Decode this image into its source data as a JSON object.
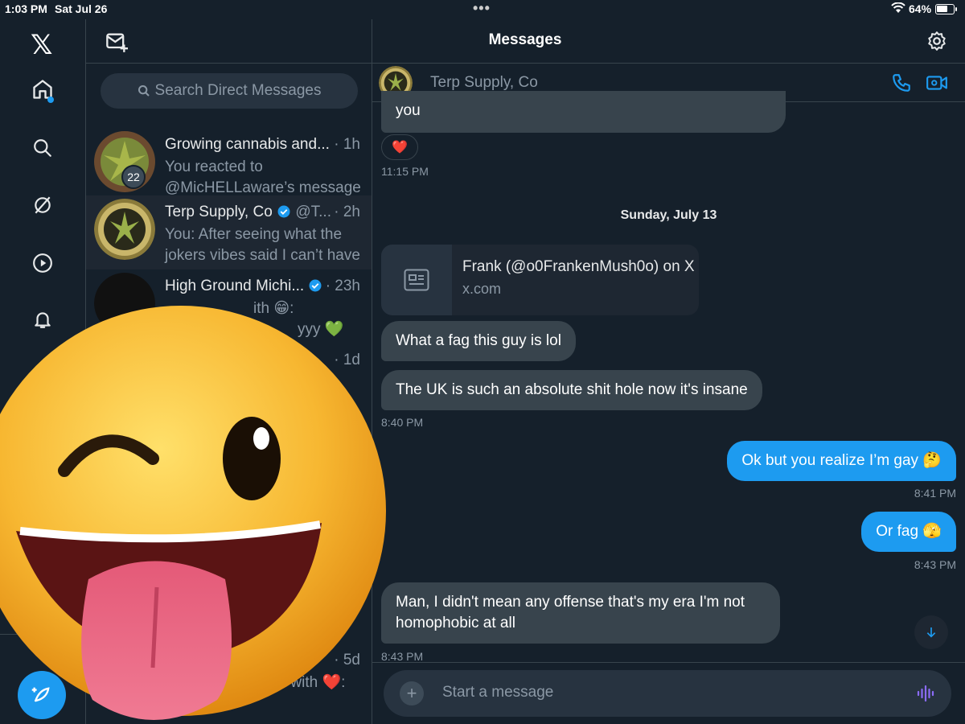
{
  "status_bar": {
    "time": "1:03 PM",
    "date": "Sat Jul 26",
    "battery": "64%"
  },
  "header": {
    "title": "Messages"
  },
  "search": {
    "placeholder": "Search Direct Messages"
  },
  "conversations": [
    {
      "name": "Growing cannabis and...",
      "time": "· 1h",
      "preview": "You reacted to @MicHELLaware’s message",
      "badge": "22"
    },
    {
      "name": "Terp Supply, Co",
      "handle": "@T...",
      "time": "· 2h",
      "preview": "You: After seeing what the jokers vibes said I can’t have"
    },
    {
      "name": "High Ground Michi...",
      "time": "· 23h",
      "preview_a": "ith 😁:",
      "preview_b": "yyy 💚"
    },
    {
      "time": "· 1d"
    },
    {
      "name": "...",
      "time": "· 5d",
      "preview": "ed with ❤️:"
    }
  ],
  "chat": {
    "contact_name": "Terp Supply, Co",
    "messages": [
      {
        "text": "you"
      },
      {
        "reaction": "❤️",
        "time": "11:15 PM"
      },
      {
        "day": "Sunday, July 13"
      },
      {
        "link_title": "Frank (@o0FrankenMush0o) on X",
        "link_domain": "x.com"
      },
      {
        "text": "What a fag this guy is lol"
      },
      {
        "text": "The UK is such an absolute shit hole now it's insane",
        "time": "8:40 PM"
      },
      {
        "text": "Ok but you realize I’m gay 🤔",
        "time": "8:41 PM"
      },
      {
        "text": "Or fag 🫣",
        "time": "8:43 PM"
      },
      {
        "text": "Man, I didn't mean any offense that's my era I'm not homophobic at all",
        "time": "8:43 PM"
      }
    ],
    "composer_placeholder": "Start a message"
  },
  "colors": {
    "accent": "#1d9bf0",
    "background": "#15202b",
    "bubble_in": "#38444d"
  }
}
